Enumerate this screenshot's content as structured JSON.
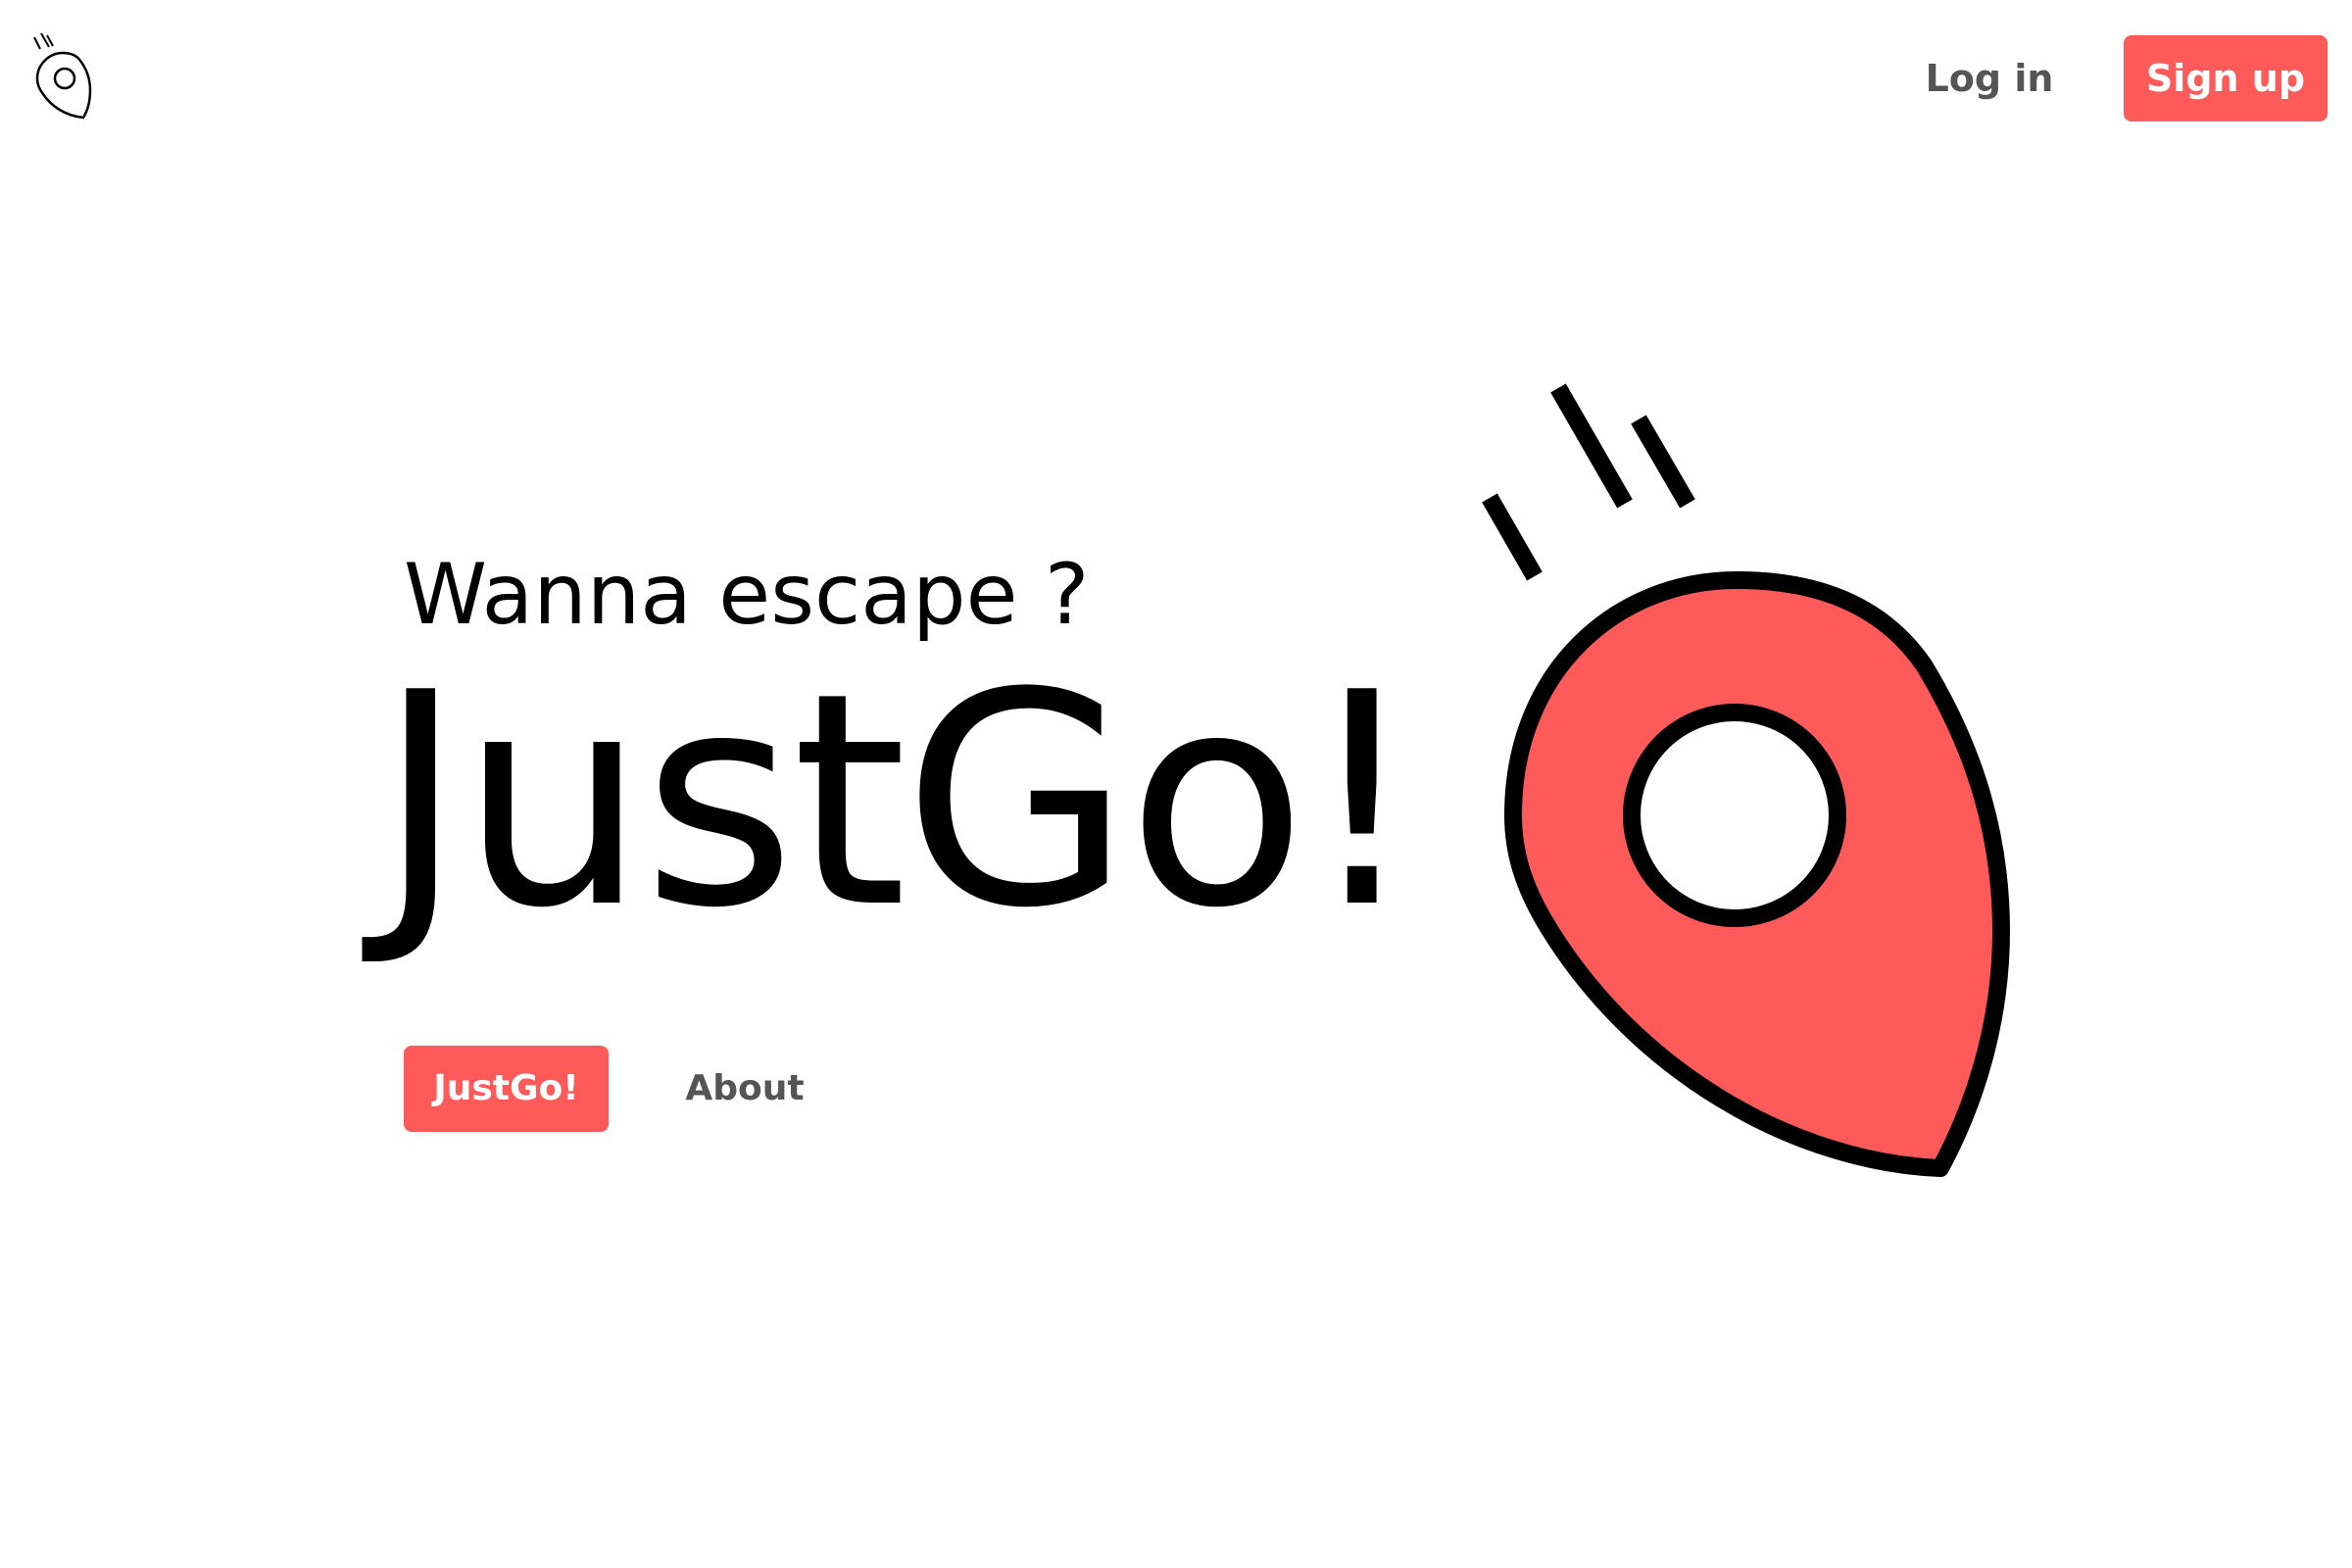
{
  "header": {
    "logo_icon": "map-pin-icon",
    "login_label": "Log in",
    "signup_label": "Sign up"
  },
  "hero": {
    "tagline": "Wanna escape ?",
    "brand": "JustGo!",
    "cta_label": "JustGo!",
    "about_label": "About",
    "illustration_icon": "map-pin-icon"
  },
  "colors": {
    "accent": "#ff5a5a",
    "text": "#000000",
    "muted_text": "#555555",
    "background": "#ffffff"
  }
}
